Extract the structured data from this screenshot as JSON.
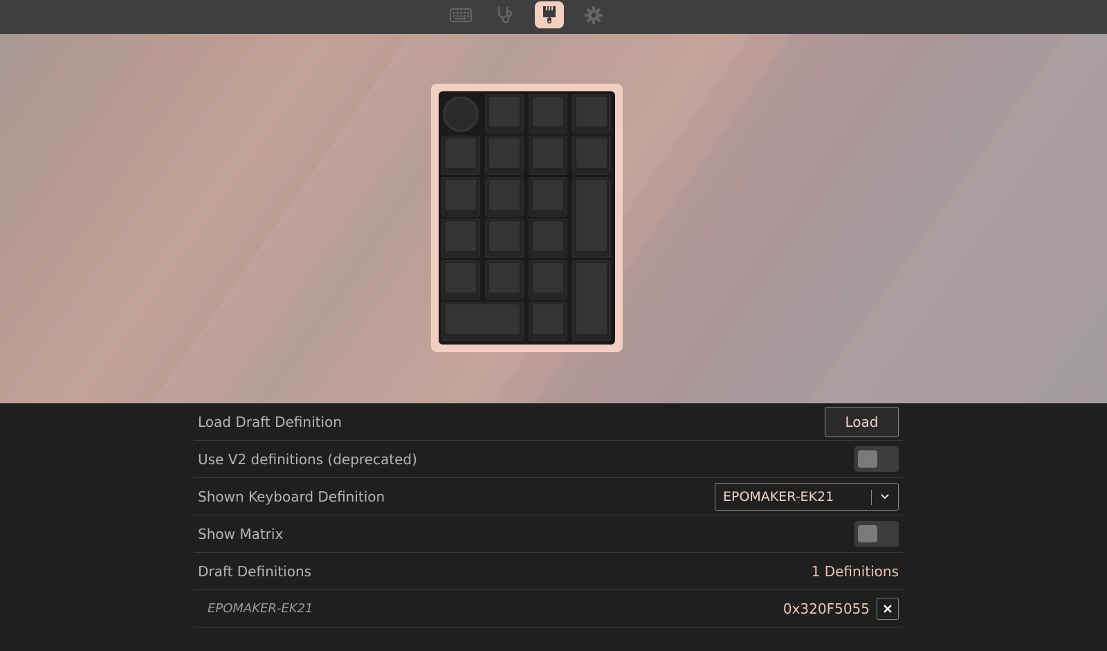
{
  "nav": {
    "items": [
      {
        "name": "keyboard-icon",
        "active": false
      },
      {
        "name": "stethoscope-icon",
        "active": false
      },
      {
        "name": "paintbrush-icon",
        "active": true
      },
      {
        "name": "gear-icon",
        "active": false
      }
    ],
    "active_color": "#f2cfc0"
  },
  "keyboard": {
    "name": "EPOMAKER-EK21",
    "frame_color": "#f2cfc2"
  },
  "settings": {
    "load_draft": {
      "label": "Load Draft Definition",
      "button": "Load"
    },
    "use_v2": {
      "label": "Use V2 definitions (deprecated)",
      "enabled": false
    },
    "shown_definition": {
      "label": "Shown Keyboard Definition",
      "value": "EPOMAKER-EK21"
    },
    "show_matrix": {
      "label": "Show Matrix",
      "enabled": false
    },
    "draft_definitions": {
      "label": "Draft Definitions",
      "count_text": "1 Definitions"
    },
    "definitions": [
      {
        "name": "EPOMAKER-EK21",
        "id": "0x320F5055"
      }
    ]
  }
}
